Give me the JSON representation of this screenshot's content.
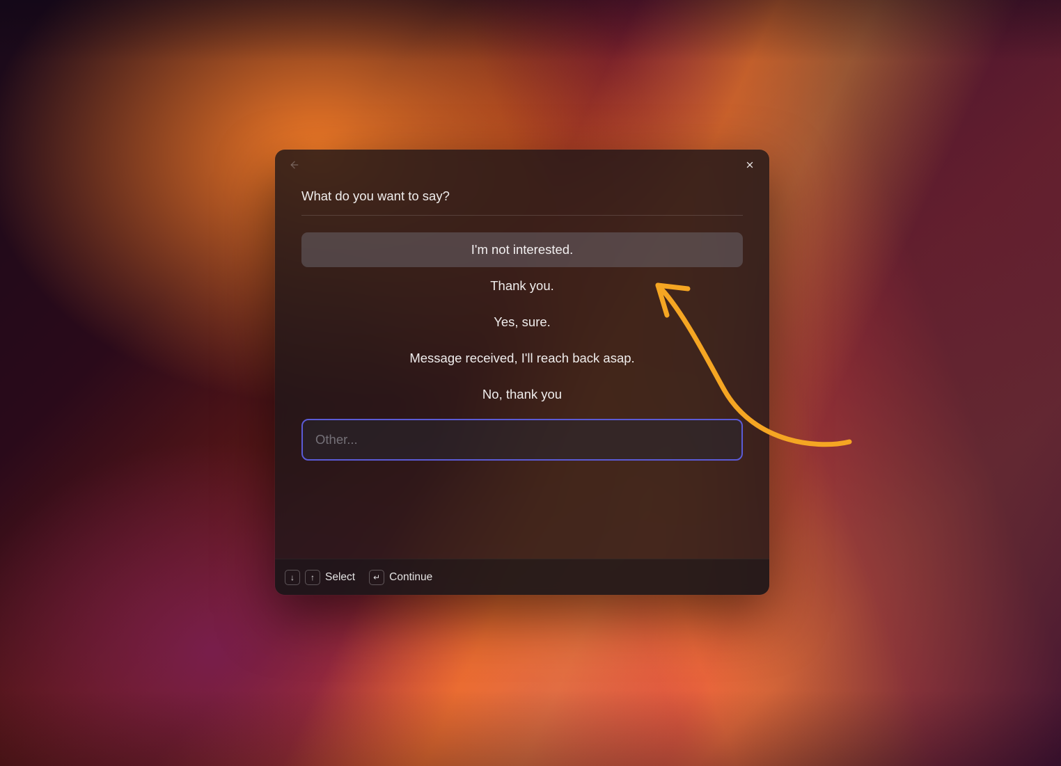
{
  "modal": {
    "prompt": "What do you want to say?",
    "options": [
      {
        "label": "I'm not interested.",
        "selected": true
      },
      {
        "label": "Thank you.",
        "selected": false
      },
      {
        "label": "Yes, sure.",
        "selected": false
      },
      {
        "label": "Message received, I'll reach back asap.",
        "selected": false
      },
      {
        "label": "No, thank you",
        "selected": false
      }
    ],
    "other_placeholder": "Other..."
  },
  "footer": {
    "select_label": "Select",
    "continue_label": "Continue",
    "key_down": "↓",
    "key_up": "↑",
    "key_enter": "↵"
  },
  "annotation": {
    "arrow_color": "#f5a623"
  }
}
